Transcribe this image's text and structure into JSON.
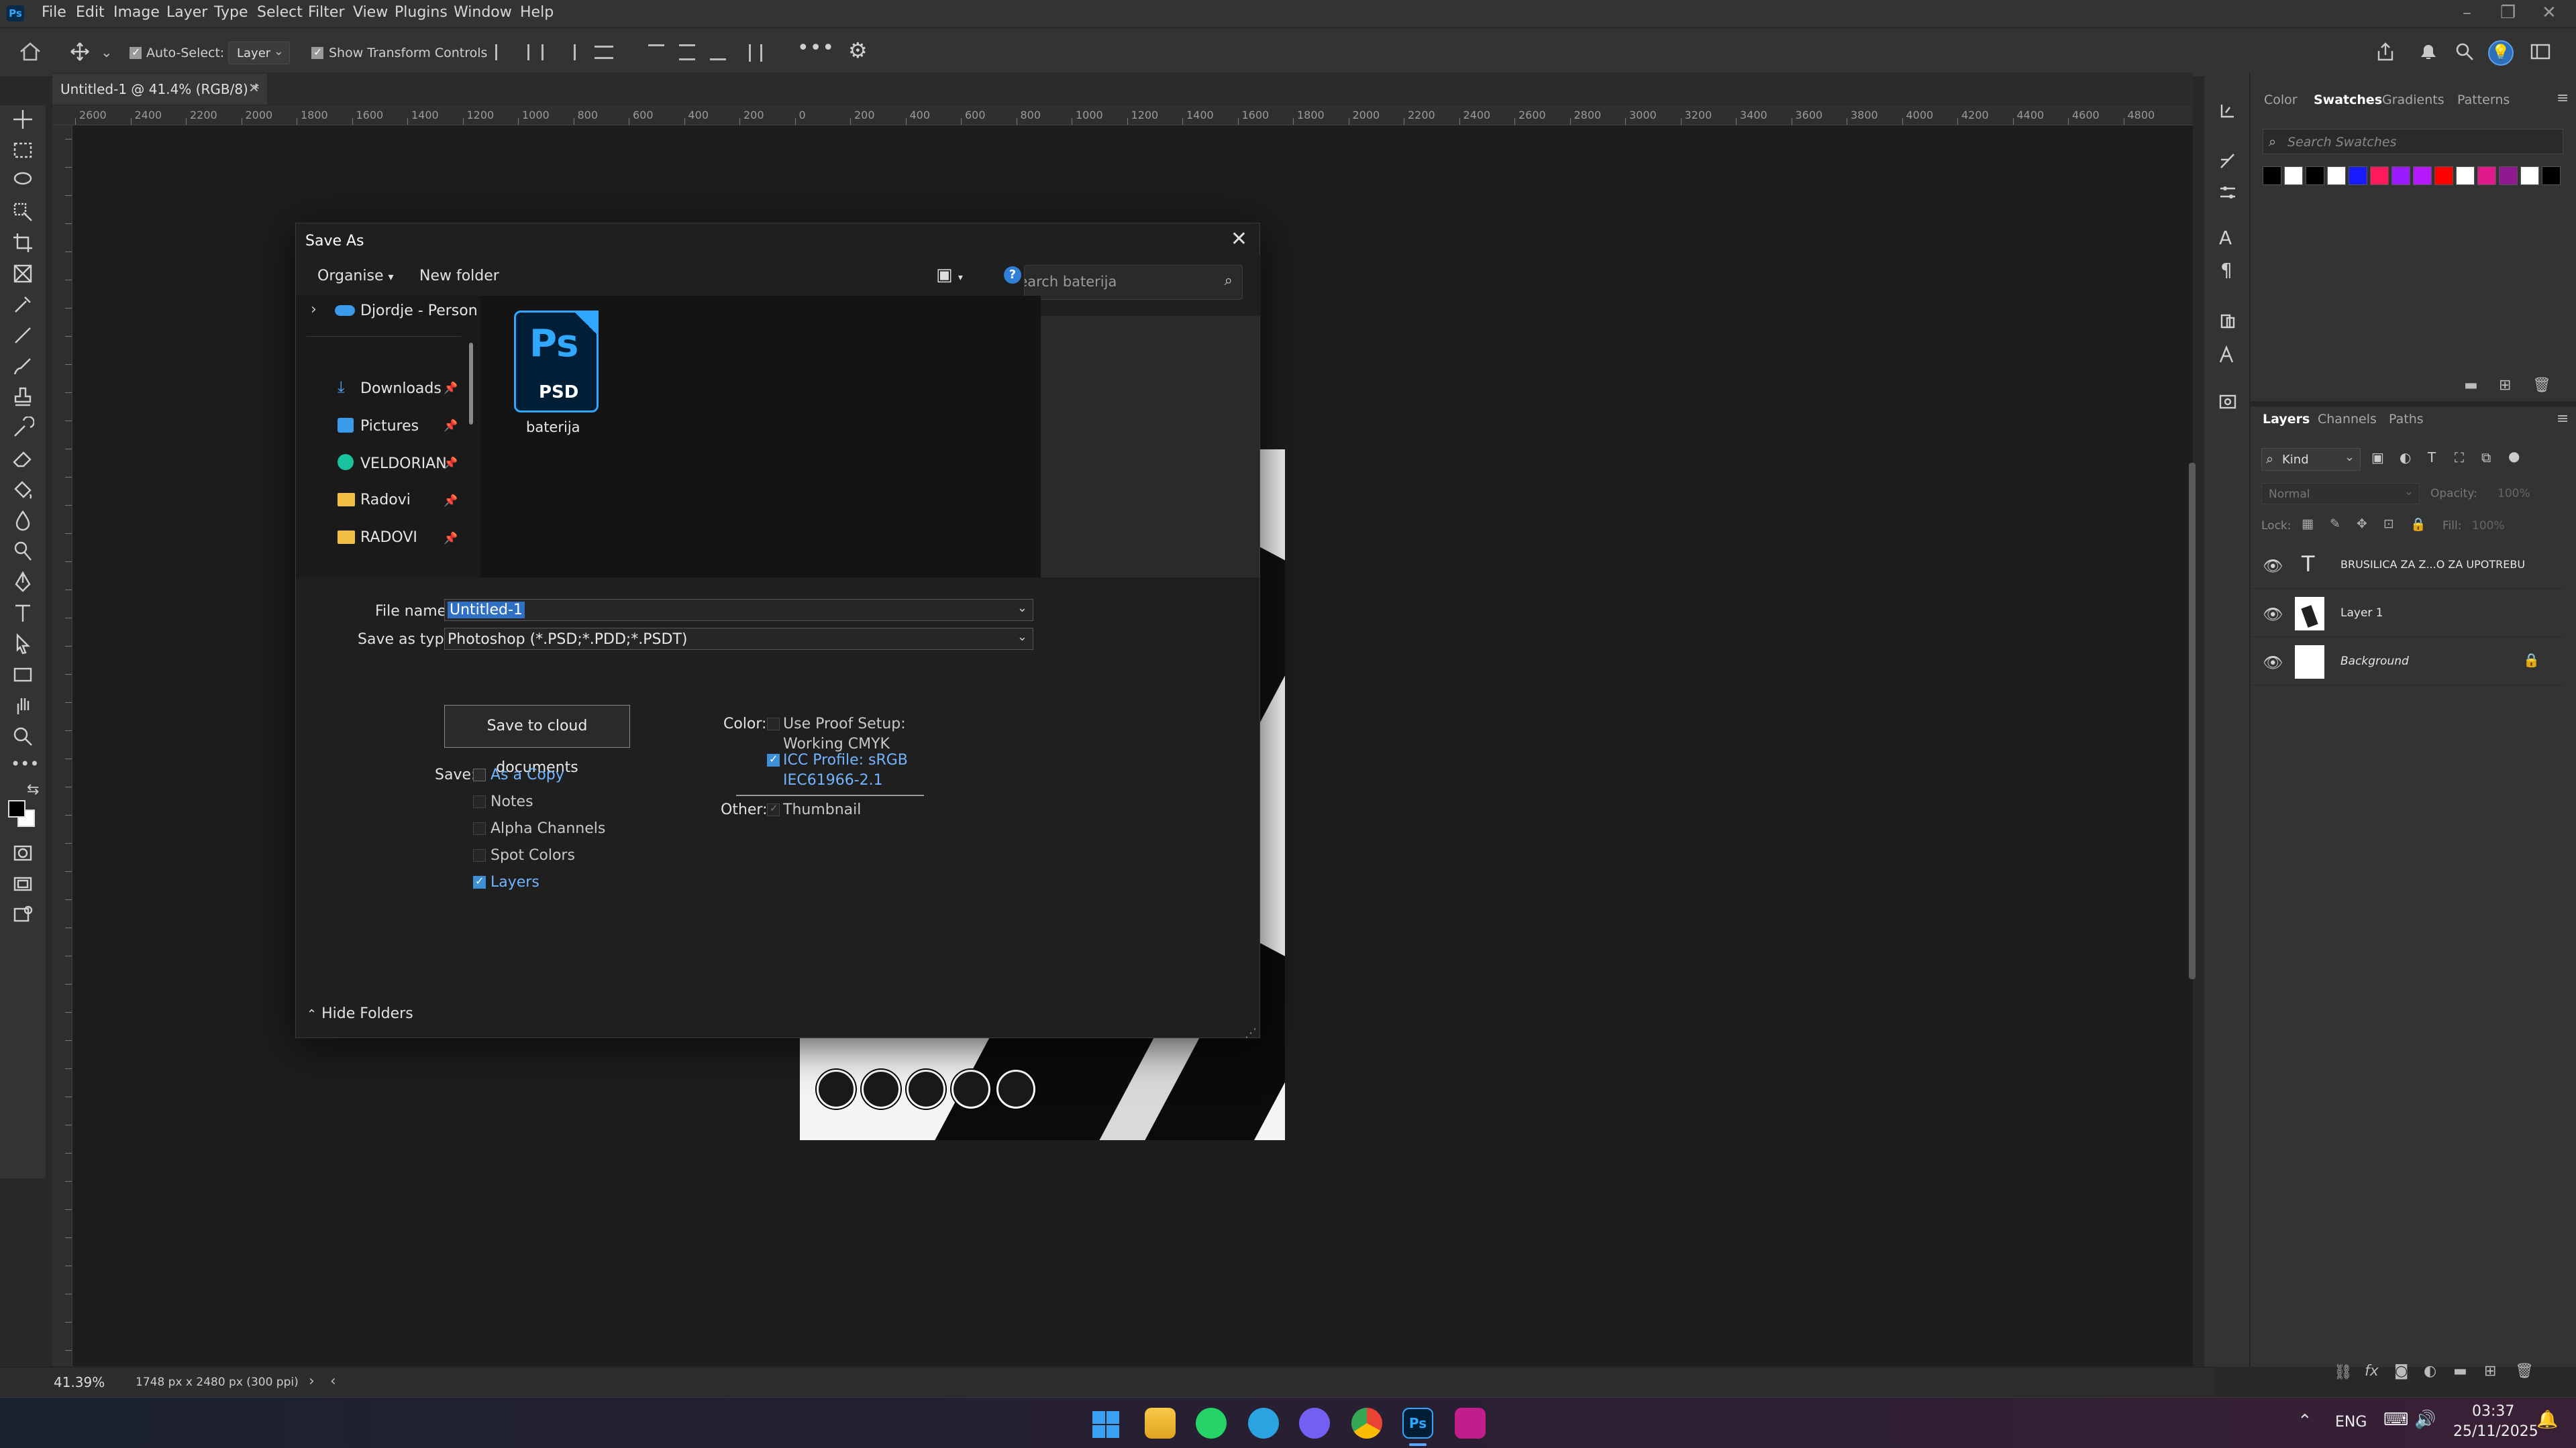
{
  "menubar": {
    "app_badge": "Ps",
    "items": [
      "File",
      "Edit",
      "Image",
      "Layer",
      "Type",
      "Select",
      "Filter",
      "View",
      "Plugins",
      "Window",
      "Help"
    ]
  },
  "options": {
    "auto_select_label": "Auto-Select:",
    "auto_select_value": "Layer",
    "transform_label": "Show Transform Controls"
  },
  "document": {
    "tab_title": "Untitled-1 @ 41.4% (RGB/8) *"
  },
  "ruler": {
    "ticks": [
      "2600",
      "2400",
      "2200",
      "2000",
      "1800",
      "1600",
      "1400",
      "1200",
      "1000",
      "800",
      "600",
      "400",
      "200",
      "0",
      "200",
      "400",
      "600",
      "800",
      "1000",
      "1200",
      "1400",
      "1600",
      "1800",
      "2000",
      "2200",
      "2400",
      "2600",
      "2800",
      "3000",
      "3200",
      "3400",
      "3600",
      "3800",
      "4000",
      "4200",
      "4400",
      "4600",
      "4800"
    ]
  },
  "panels": {
    "top_tabs": [
      "Color",
      "Swatches",
      "Gradients",
      "Patterns"
    ],
    "active_top_tab": "Swatches",
    "search_placeholder": "Search Swatches",
    "swatch_colors": [
      "#000000",
      "#ffffff",
      "#000000",
      "#ffffff",
      "#1a1aff",
      "#ff1a5e",
      "#9b1aff",
      "#b51aff",
      "#ff0000",
      "#ffffff",
      "#e01a8a",
      "#8f1a8f",
      "#ffffff",
      "#000000"
    ],
    "layer_tabs": [
      "Layers",
      "Channels",
      "Paths"
    ],
    "active_layer_tab": "Layers",
    "kind_label": "Kind",
    "blend_mode": "Normal",
    "opacity_label": "Opacity:",
    "opacity_value": "100%",
    "lock_label": "Lock:",
    "fill_label": "Fill:",
    "fill_value": "100%",
    "layers": [
      {
        "name": "BRUSILICA ZA Z...O ZA UPOTREBU",
        "type": "text"
      },
      {
        "name": "Layer 1",
        "type": "image"
      },
      {
        "name": "Background",
        "type": "background"
      }
    ]
  },
  "statusbar": {
    "zoom": "41.39%",
    "doc_info": "1748 px x 2480 px (300 ppi)"
  },
  "dialog": {
    "title": "Save As",
    "organise": "Organise",
    "new_folder": "New folder",
    "search_placeholder": "Search baterija",
    "nav_items": [
      {
        "label": "Djordje - Person",
        "icon": "onedrive-cloud-icon"
      },
      {
        "label": "Downloads",
        "icon": "download-icon"
      },
      {
        "label": "Pictures",
        "icon": "pictures-icon"
      },
      {
        "label": "VELDORIAN",
        "icon": "user-icon"
      },
      {
        "label": "Radovi",
        "icon": "folder-icon"
      },
      {
        "label": "RADOVI",
        "icon": "folder-icon"
      }
    ],
    "file": {
      "badge_top": "Ps",
      "badge_bottom": "PSD",
      "name": "baterija"
    },
    "file_name_label": "File name:",
    "file_name_value": "Untitled-1",
    "type_label": "Save as type:",
    "type_value": "Photoshop (*.PSD;*.PDD;*.PSDT)",
    "cloud_button": "Save to cloud documents",
    "save_label": "Save:",
    "save_options": [
      {
        "label": "As a Copy",
        "checked": false,
        "enabled": true
      },
      {
        "label": "Notes",
        "checked": false,
        "enabled": false
      },
      {
        "label": "Alpha Channels",
        "checked": false,
        "enabled": false
      },
      {
        "label": "Spot Colors",
        "checked": false,
        "enabled": false
      },
      {
        "label": "Layers",
        "checked": true,
        "enabled": true
      }
    ],
    "color_label": "Color:",
    "proof_setup_line1": "Use Proof Setup:",
    "proof_setup_line2": "Working CMYK",
    "icc_line1": "ICC Profile:  sRGB",
    "icc_line2": "IEC61966-2.1",
    "other_label": "Other:",
    "thumbnail_label": "Thumbnail",
    "hide_folders": "Hide Folders"
  },
  "taskbar": {
    "lang": "ENG",
    "time": "03:37",
    "date": "25/11/2025"
  }
}
